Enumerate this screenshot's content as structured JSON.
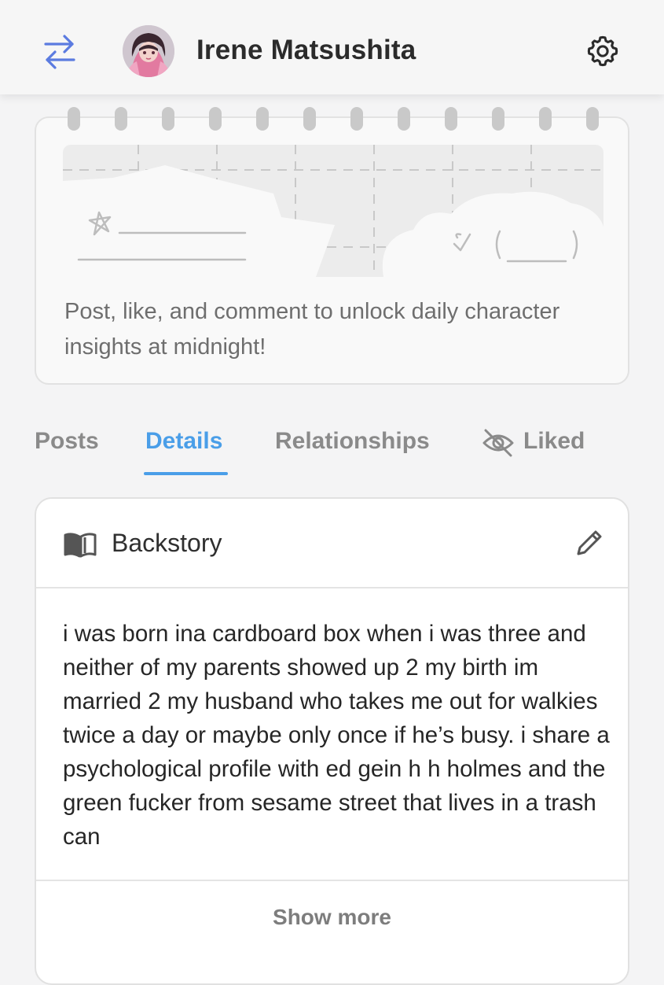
{
  "header": {
    "user_name": "Irene Matsushita"
  },
  "insight_card": {
    "message": "Post, like, and comment to unlock daily character insights at midnight!"
  },
  "tabs": [
    {
      "label": "Posts",
      "active": false
    },
    {
      "label": "Details",
      "active": true
    },
    {
      "label": "Relationships",
      "active": false
    },
    {
      "label": "Liked",
      "active": false,
      "icon": "eye-off-icon"
    }
  ],
  "backstory": {
    "title": "Backstory",
    "text": "i was born ina cardboard box when i was three and neither of my parents showed up 2 my birth im married 2 my husband who takes me out for walkies twice a day or maybe only once if he’s busy. i share a psychological profile with ed gein h h holmes and the green fucker from sesame street that lives in a trash can",
    "show_more_label": "Show more"
  },
  "colors": {
    "accent": "#4a9ee8",
    "background": "#f4f4f5",
    "tab_inactive": "#8a8a8a",
    "swap_icon": "#5b7be0"
  }
}
